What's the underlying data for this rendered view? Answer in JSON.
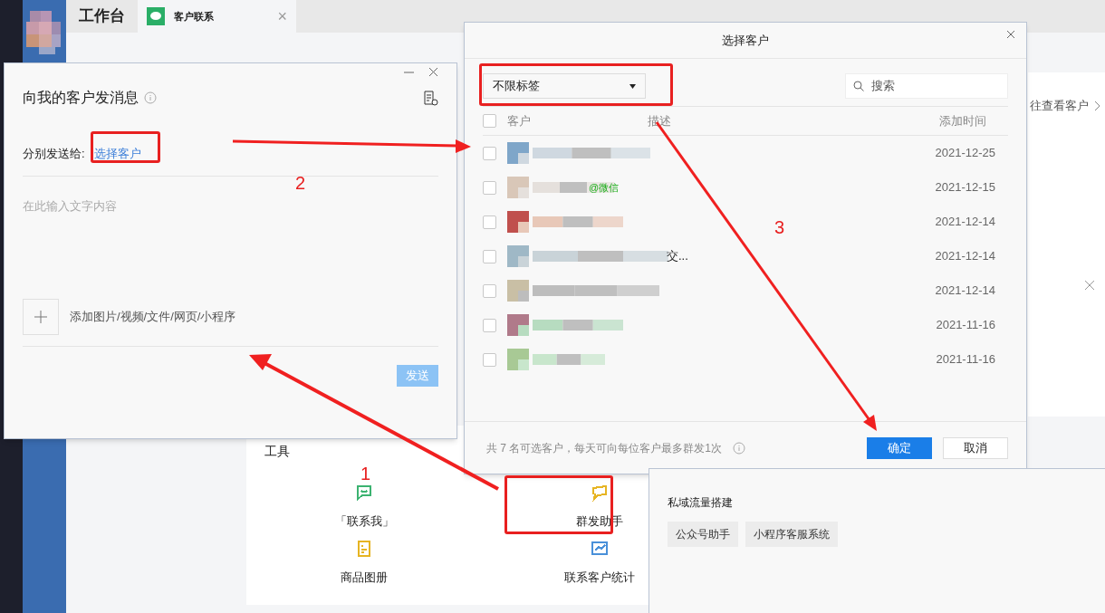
{
  "app_tabs": [
    {
      "label": "工作台",
      "kind": "home",
      "selected": false
    },
    {
      "label": "客户联系",
      "kind": "app",
      "selected": true,
      "close": "×"
    }
  ],
  "background": {
    "link": "往查看客户",
    "tools_title": "工具",
    "tools": [
      {
        "label": "「联系我」",
        "color": "#3cb371",
        "kind": "chat"
      },
      {
        "label": "群发助手",
        "color": "#e6b422",
        "kind": "bubble"
      },
      {
        "label": "商品图册",
        "color": "#e6b422",
        "kind": "doc"
      },
      {
        "label": "联系客户统计",
        "color": "#4a90d9",
        "kind": "chart"
      }
    ]
  },
  "message_dialog": {
    "title": "向我的客户发消息",
    "send_to_label": "分别发送给:",
    "send_to_link": "选择客户",
    "placeholder": "在此输入文字内容",
    "attach_label": "添加图片/视频/文件/网页/小程序",
    "send_button": {
      "label": "发送",
      "disabled": true
    }
  },
  "select_dialog": {
    "title": "选择客户",
    "tag_filter": "不限标签",
    "search_placeholder": "搜索",
    "columns": [
      "客户",
      "描述",
      "添加时间"
    ],
    "select_all": false,
    "rows": [
      {
        "checked": false,
        "kind": "plain",
        "date": "2021-12-25"
      },
      {
        "checked": false,
        "kind": "wechat",
        "suffix": "@微信",
        "date": "2021-12-15"
      },
      {
        "checked": false,
        "kind": "plain",
        "date": "2021-12-14"
      },
      {
        "checked": false,
        "kind": "name",
        "suffix": "交...",
        "date": "2021-12-14"
      },
      {
        "checked": false,
        "kind": "plain",
        "date": "2021-12-14"
      },
      {
        "checked": false,
        "kind": "plain",
        "date": "2021-11-16"
      },
      {
        "checked": false,
        "kind": "plain",
        "date": "2021-11-16"
      }
    ],
    "footer_note": "共 7 名可选客户，每天可向每位客户最多群发1次",
    "confirm": "确定",
    "cancel": "取消"
  },
  "side_panel": {
    "title": "私域流量搭建",
    "tags": [
      "公众号助手",
      "小程序客服系统"
    ]
  },
  "annotations": {
    "steps": [
      "1",
      "2",
      "3"
    ]
  }
}
